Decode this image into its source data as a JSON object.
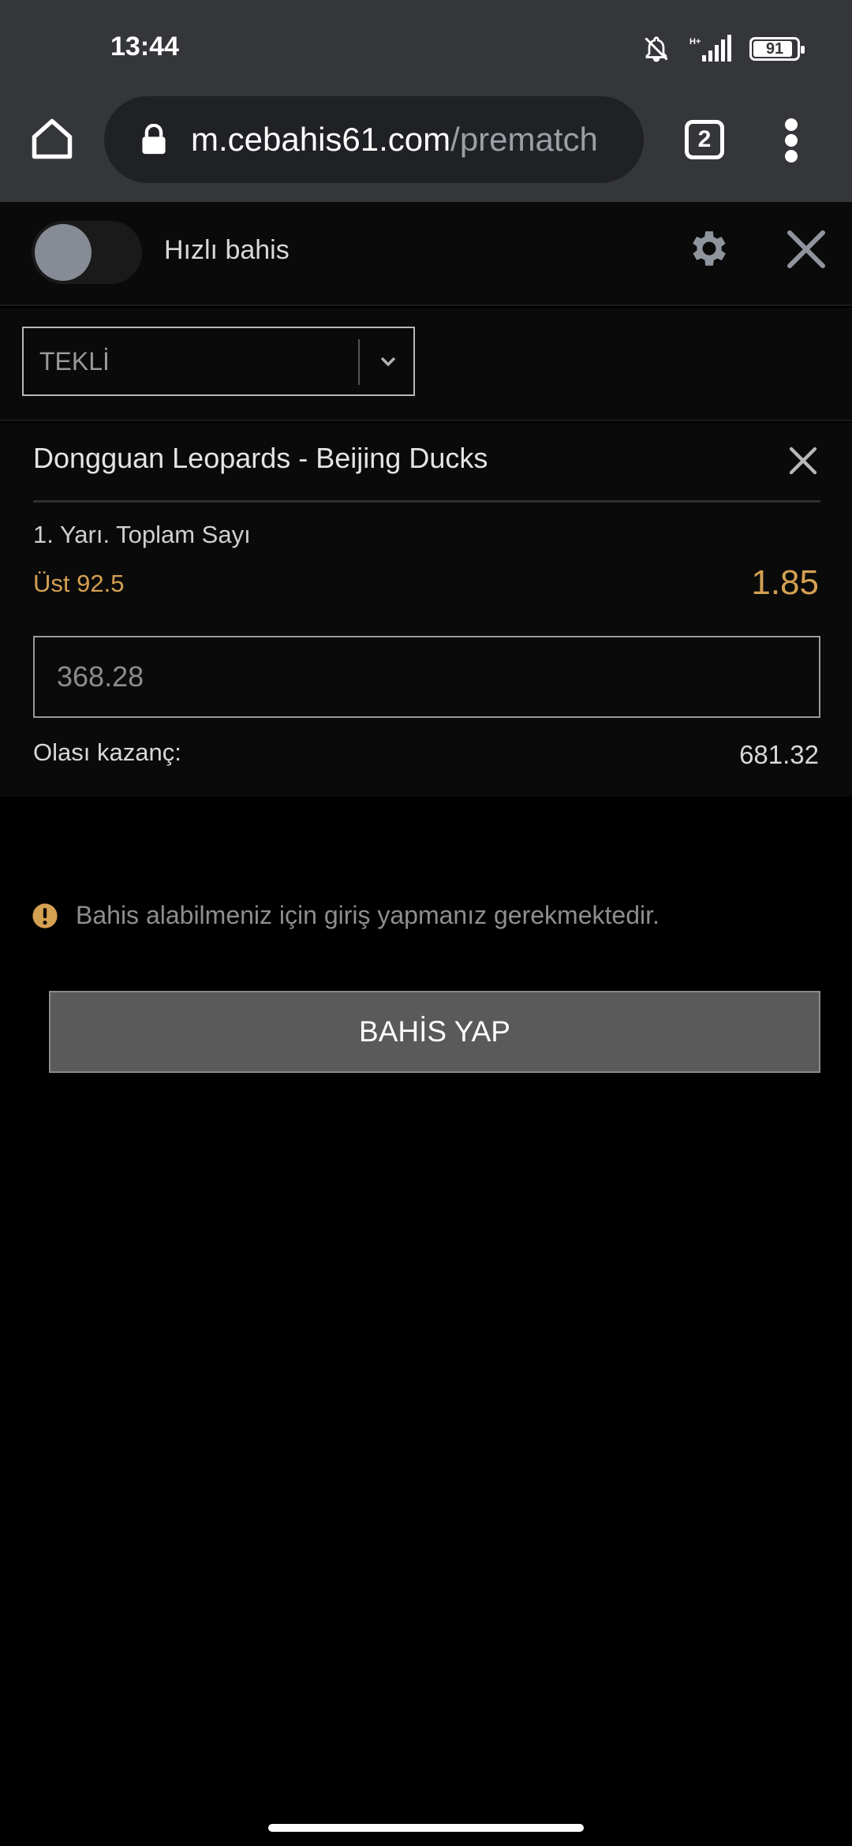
{
  "status_bar": {
    "time": "13:44",
    "network": "H+",
    "battery": "91",
    "icons": [
      "bell-off-icon",
      "signal-icon",
      "battery-icon"
    ]
  },
  "browser": {
    "url_host": "m.cebahis61.com",
    "url_path": "/prematch",
    "tab_count": "2",
    "icons": [
      "home-icon",
      "lock-icon",
      "more-vert-icon"
    ]
  },
  "slip": {
    "quick_bet_label": "Hızlı bahis",
    "bet_type": "TEKLİ",
    "icons": [
      "gear-icon",
      "close-icon",
      "chevron-down-icon"
    ]
  },
  "bet": {
    "match": "Dongguan Leopards - Beijing Ducks",
    "market": "1. Yarı. Toplam Sayı",
    "selection": "Üst 92.5",
    "odds": "1.85",
    "stake_placeholder": "368.28",
    "potential_win_label": "Olası kazanç:",
    "potential_win_value": "681.32"
  },
  "notice": {
    "text": "Bahis alabilmeniz için giriş yapmanız gerekmektedir.",
    "icon": "warning-icon"
  },
  "actions": {
    "place_bet_label": "BAHİS YAP"
  },
  "colors": {
    "accent": "#d4a052",
    "chrome": "#35363a",
    "button": "#5a5a5a"
  }
}
